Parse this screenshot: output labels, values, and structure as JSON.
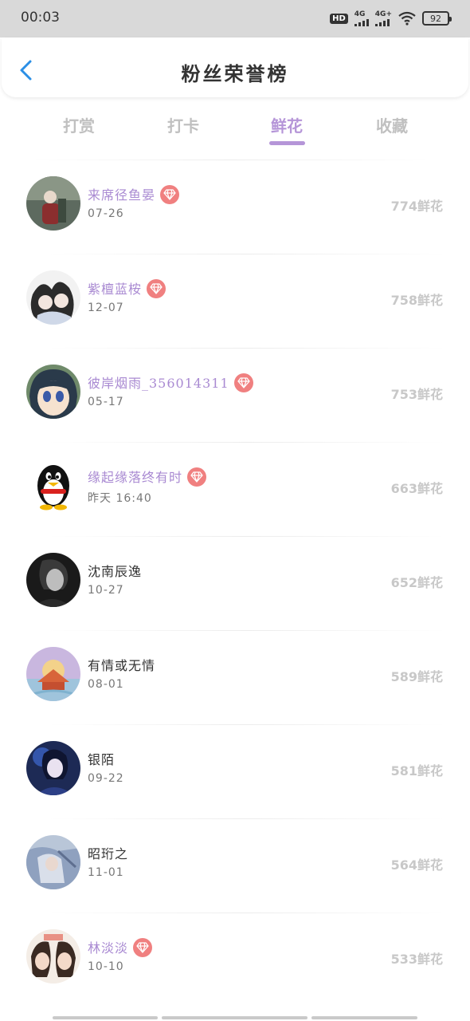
{
  "status_bar": {
    "time": "00:03",
    "hd": "HD",
    "sim1_label": "4G",
    "sim2_label": "4G+",
    "battery": "92"
  },
  "header": {
    "title": "粉丝荣誉榜",
    "back_icon": "chevron-left-icon"
  },
  "tabs": [
    {
      "label": "打赏",
      "active": false
    },
    {
      "label": "打卡",
      "active": false
    },
    {
      "label": "鲜花",
      "active": true
    },
    {
      "label": "收藏",
      "active": false
    }
  ],
  "colors": {
    "accent": "#b595d8",
    "vip_name": "#a98ad2",
    "gem_badge": "#f08080",
    "score": "#c8c8c8"
  },
  "fans": [
    {
      "name": "来席径鱼晏",
      "date": "07-26",
      "score": "774鲜花",
      "vip": true
    },
    {
      "name": "紫檀蓝桉",
      "date": "12-07",
      "score": "758鲜花",
      "vip": true
    },
    {
      "name": "彼岸烟雨_356014311",
      "date": "05-17",
      "score": "753鲜花",
      "vip": true
    },
    {
      "name": "缘起缘落终有时",
      "date": "昨天 16:40",
      "score": "663鲜花",
      "vip": true
    },
    {
      "name": "沈南辰逸",
      "date": "10-27",
      "score": "652鲜花",
      "vip": false
    },
    {
      "name": "有情或无情",
      "date": "08-01",
      "score": "589鲜花",
      "vip": false
    },
    {
      "name": "银陌",
      "date": "09-22",
      "score": "581鲜花",
      "vip": false
    },
    {
      "name": "昭珩之",
      "date": "11-01",
      "score": "564鲜花",
      "vip": false
    },
    {
      "name": "林淡淡",
      "date": "10-10",
      "score": "533鲜花",
      "vip": true
    }
  ]
}
